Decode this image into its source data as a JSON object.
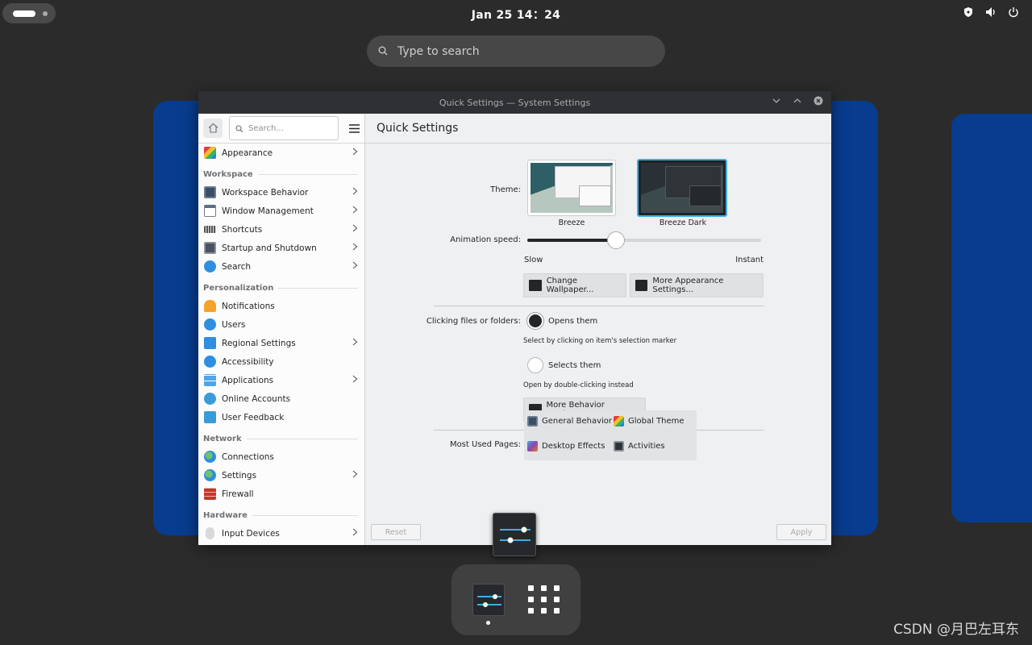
{
  "topbar": {
    "clock": "Jan 25  14：24"
  },
  "search": {
    "placeholder": "Type to search"
  },
  "window": {
    "title": "Quick Settings  — System Settings",
    "sidebar": {
      "search_placeholder": "Search...",
      "top_item": "Appearance",
      "groups": [
        {
          "heading": "Workspace",
          "items": [
            "Workspace Behavior",
            "Window Management",
            "Shortcuts",
            "Startup and Shutdown",
            "Search"
          ]
        },
        {
          "heading": "Personalization",
          "items": [
            "Notifications",
            "Users",
            "Regional Settings",
            "Accessibility",
            "Applications",
            "Online Accounts",
            "User Feedback"
          ]
        },
        {
          "heading": "Network",
          "items": [
            "Connections",
            "Settings",
            "Firewall"
          ]
        },
        {
          "heading": "Hardware",
          "items": [
            "Input Devices"
          ]
        }
      ]
    },
    "content": {
      "page_title": "Quick Settings",
      "theme_label": "Theme:",
      "themes": [
        "Breeze",
        "Breeze Dark"
      ],
      "selected_theme": "Breeze Dark",
      "animation_label": "Animation speed:",
      "animation_value": 0.38,
      "slow_label": "Slow",
      "instant_label": "Instant",
      "change_wallpaper": "Change Wallpaper...",
      "more_appearance": "More Appearance Settings...",
      "clicking_label": "Clicking files or folders:",
      "opens_them": "Opens them",
      "opens_hint": "Select by clicking on item's selection marker",
      "selects_them": "Selects them",
      "selects_hint": "Open by double-clicking instead",
      "more_behavior": "More Behavior Settings...",
      "most_used_label": "Most Used Pages:",
      "most_used": [
        "General Behavior",
        "Global Theme",
        "Desktop Effects",
        "Activities"
      ],
      "reset": "Reset",
      "apply": "Apply"
    }
  },
  "watermark": "CSDN @月巴左耳东",
  "colors": {
    "accent": "#3daee9",
    "workspace": "#083c8f"
  }
}
